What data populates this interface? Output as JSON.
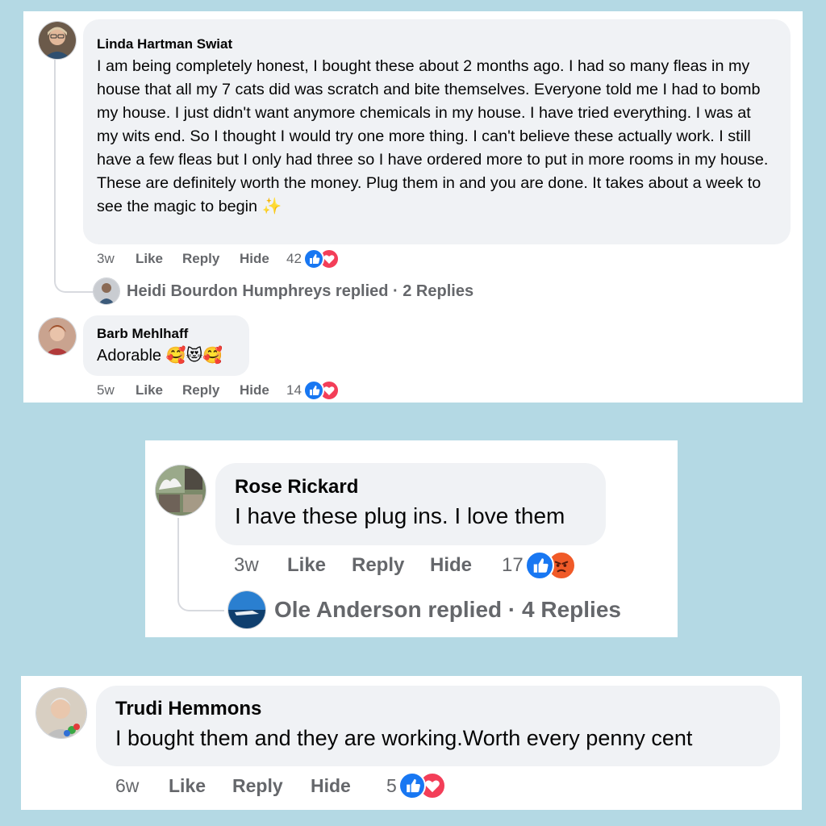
{
  "comments": [
    {
      "author": "Linda Hartman Swiat",
      "text": "I am being completely honest, I bought these about 2 months ago. I had so many fleas in my house that all my 7 cats did was scratch and bite themselves. Everyone told me I had to bomb my house. I just didn't want anymore chemicals in my house. I have tried everything. I was at my wits end. So I thought I would try one more thing. I can't believe these actually work. I still have a few fleas but I only had three so I have ordered more to put in more rooms in my house. These are definitely worth the money. Plug them in and you are done. It takes about a week to see the magic to begin",
      "emoji": "✨",
      "time": "3w",
      "like_label": "Like",
      "reply_label": "Reply",
      "hide_label": "Hide",
      "reaction_count": "42",
      "reactions": [
        "like-icon",
        "love-icon"
      ],
      "replies_text": "Heidi Bourdon Humphreys replied · 2 Replies"
    },
    {
      "author": "Barb Mehlhaff",
      "text": "Adorable",
      "emoji": "🥰😻🥰",
      "time": "5w",
      "like_label": "Like",
      "reply_label": "Reply",
      "hide_label": "Hide",
      "reaction_count": "14",
      "reactions": [
        "like-icon",
        "love-icon"
      ]
    },
    {
      "author": "Rose Rickard",
      "text": "I have these plug ins. I love them",
      "time": "3w",
      "like_label": "Like",
      "reply_label": "Reply",
      "hide_label": "Hide",
      "reaction_count": "17",
      "reactions": [
        "like-icon",
        "angry-icon"
      ],
      "replies_text": "Ole Anderson replied · 4 Replies"
    },
    {
      "author": "Trudi Hemmons",
      "text": "I bought them and they are working.Worth every penny cent",
      "time": "6w",
      "like_label": "Like",
      "reply_label": "Reply",
      "hide_label": "Hide",
      "reaction_count": "5",
      "reactions": [
        "like-icon",
        "love-icon"
      ]
    }
  ],
  "colors": {
    "background": "#b4d9e4",
    "bubble": "#f0f2f5",
    "meta_text": "#65676b",
    "like_blue": "#1877f2",
    "love_red": "#f33e58",
    "angry_orange": "#f05a28"
  }
}
